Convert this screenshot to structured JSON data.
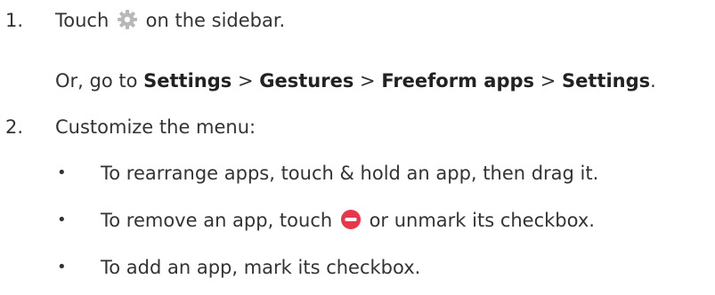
{
  "step1": {
    "number": "1.",
    "text_before": "Touch",
    "text_after": "on the sidebar.",
    "icon": "gear-icon",
    "alt_path": {
      "prefix": "Or, go to",
      "items": [
        "Settings",
        "Gestures",
        "Freeform apps",
        "Settings"
      ],
      "separator": ">",
      "suffix": "."
    }
  },
  "step2": {
    "number": "2.",
    "text": "Customize the menu:",
    "bullets": [
      {
        "text": "To rearrange apps, touch & hold an app, then drag it."
      },
      {
        "text_before": "To remove an app, touch",
        "icon": "remove-circle-icon",
        "text_after": "or unmark its checkbox."
      },
      {
        "text": "To add an app, mark its checkbox."
      }
    ]
  },
  "colors": {
    "text": "#333333",
    "gear_icon": "#b8b8b8",
    "remove_icon": "#e8374b"
  },
  "bullet_symbol": "•"
}
